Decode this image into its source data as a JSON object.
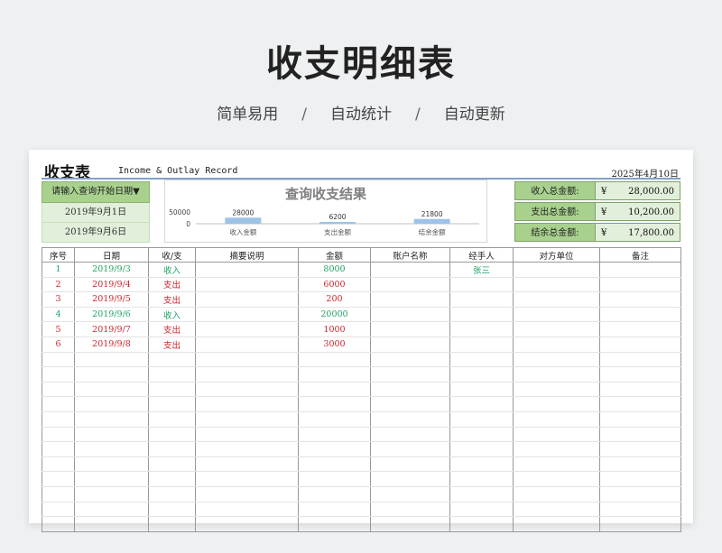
{
  "hero": {
    "title": "收支明细表",
    "tags": [
      "简单易用",
      "自动统计",
      "自动更新"
    ],
    "separator": "/"
  },
  "sheet": {
    "title": "收支表",
    "subtitle": "Income & Outlay Record",
    "date": "2025年4月10日"
  },
  "query": {
    "prompt": "请输入查询开始日期▼",
    "start_date": "2019年9月1日",
    "end_date": "2019年9月6日"
  },
  "chart_data": {
    "type": "bar",
    "title": "查询收支结果",
    "categories": [
      "收入金额",
      "支出金额",
      "结余金额"
    ],
    "values": [
      28000,
      6200,
      21800
    ],
    "y_ticks": [
      "50000",
      "0"
    ],
    "ylim": [
      0,
      50000
    ],
    "bar_color": "#9dc3e6"
  },
  "totals": [
    {
      "label": "收入总金额:",
      "currency": "¥",
      "value": "28,000.00"
    },
    {
      "label": "支出总金额:",
      "currency": "¥",
      "value": "10,200.00"
    },
    {
      "label": "结余总金额:",
      "currency": "¥",
      "value": "17,800.00"
    }
  ],
  "table": {
    "columns": [
      "序号",
      "日期",
      "收/支",
      "摘要说明",
      "金额",
      "账户名称",
      "经手人",
      "对方单位",
      "备注"
    ],
    "rows": [
      {
        "no": "1",
        "date": "2019/9/3",
        "type": "收入",
        "summary": "",
        "amount": "8000",
        "account": "",
        "handler": "张三",
        "party": "",
        "note": "",
        "kind": "income"
      },
      {
        "no": "2",
        "date": "2019/9/4",
        "type": "支出",
        "summary": "",
        "amount": "6000",
        "account": "",
        "handler": "",
        "party": "",
        "note": "",
        "kind": "expense"
      },
      {
        "no": "3",
        "date": "2019/9/5",
        "type": "支出",
        "summary": "",
        "amount": "200",
        "account": "",
        "handler": "",
        "party": "",
        "note": "",
        "kind": "expense"
      },
      {
        "no": "4",
        "date": "2019/9/6",
        "type": "收入",
        "summary": "",
        "amount": "20000",
        "account": "",
        "handler": "",
        "party": "",
        "note": "",
        "kind": "income"
      },
      {
        "no": "5",
        "date": "2019/9/7",
        "type": "支出",
        "summary": "",
        "amount": "1000",
        "account": "",
        "handler": "",
        "party": "",
        "note": "",
        "kind": "expense"
      },
      {
        "no": "6",
        "date": "2019/9/8",
        "type": "支出",
        "summary": "",
        "amount": "3000",
        "account": "",
        "handler": "",
        "party": "",
        "note": "",
        "kind": "expense"
      }
    ],
    "empty_rows": 12
  },
  "colors": {
    "income": "#1fa463",
    "expense": "#d0232c",
    "header_green": "#a9d18e",
    "light_green": "#e2efda"
  }
}
